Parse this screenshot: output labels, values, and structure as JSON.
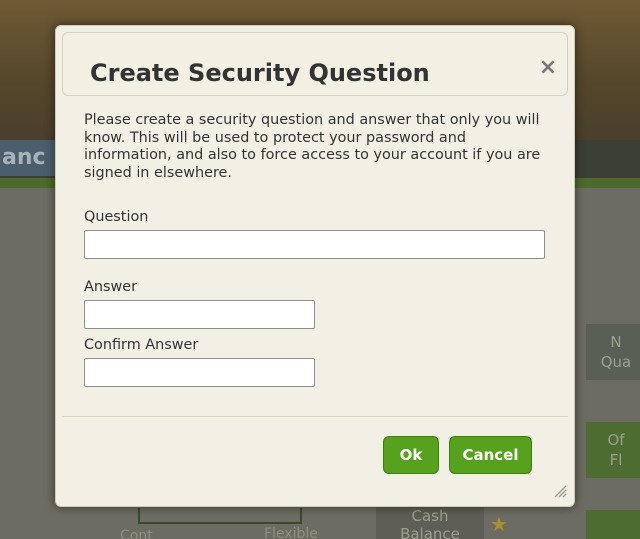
{
  "dialog": {
    "title": "Create Security Question",
    "close_glyph": "×",
    "intro": "Please create a security question and answer that only you will know. This will be used to protect your password and information, and also to force access to your account if you are signed in elsewhere.",
    "fields": {
      "question_label": "Question",
      "question_value": "",
      "answer_label": "Answer",
      "answer_value": "",
      "confirm_label": "Confirm Answer",
      "confirm_value": ""
    },
    "buttons": {
      "ok": "Ok",
      "cancel": "Cancel"
    }
  },
  "background": {
    "tab_text": "anc",
    "box1_text": "N\nQua",
    "box2_text": "Of\nFl",
    "cash_text": "Cash\nBalance",
    "left_small": "Cont",
    "right_small": "Flexible"
  },
  "colors": {
    "dialog_bg": "#f2f0e5",
    "button_green": "#57a21c",
    "overlay": "#4a4a40"
  },
  "icons": {
    "close": "close-icon",
    "resize": "resize-grip-icon",
    "star": "star-icon"
  }
}
